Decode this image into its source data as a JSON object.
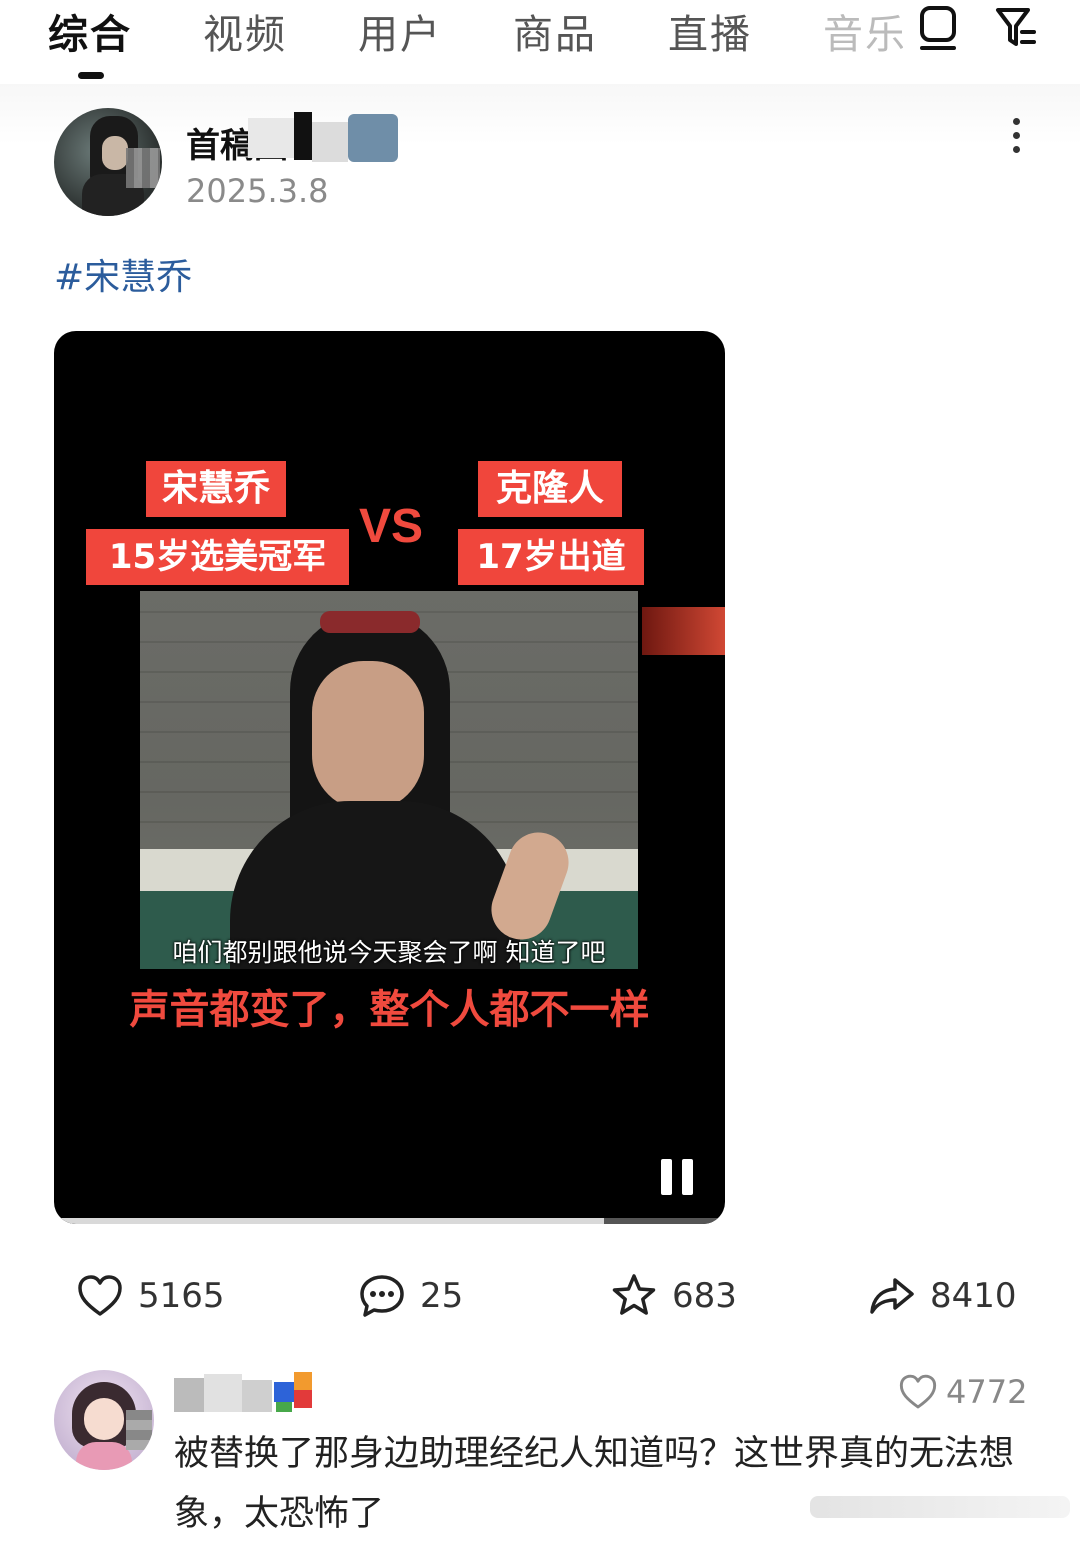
{
  "tabs": [
    {
      "label": "综合",
      "active": true
    },
    {
      "label": "视频"
    },
    {
      "label": "用户"
    },
    {
      "label": "商品"
    },
    {
      "label": "直播"
    },
    {
      "label": "音乐"
    }
  ],
  "toolbar_icons": [
    "layout-toggle-icon",
    "filter-icon"
  ],
  "post": {
    "username": "首稿园",
    "date": "2025.3.8",
    "hashtag": "#宋慧乔",
    "video": {
      "left_name": "宋慧乔",
      "left_sub": "15岁选美冠军",
      "vs": "VS",
      "right_name": "克隆人",
      "right_sub": "17岁出道",
      "subtitle": "咱们都别跟他说今天聚会了啊 知道了吧",
      "caption": "声音都变了，整个人都不一样",
      "progress": 0.82,
      "state": "playing"
    },
    "stats": {
      "likes": "5165",
      "comments": "25",
      "favorites": "683",
      "shares": "8410"
    }
  },
  "comment": {
    "username": "小思思",
    "likes": "4772",
    "text": "被替换了那身边助理经纪人知道吗？这世界真的无法想象，太恐怖了"
  },
  "colors": {
    "accent_red": "#f0463c",
    "hashtag_blue": "#2b5c9c"
  }
}
